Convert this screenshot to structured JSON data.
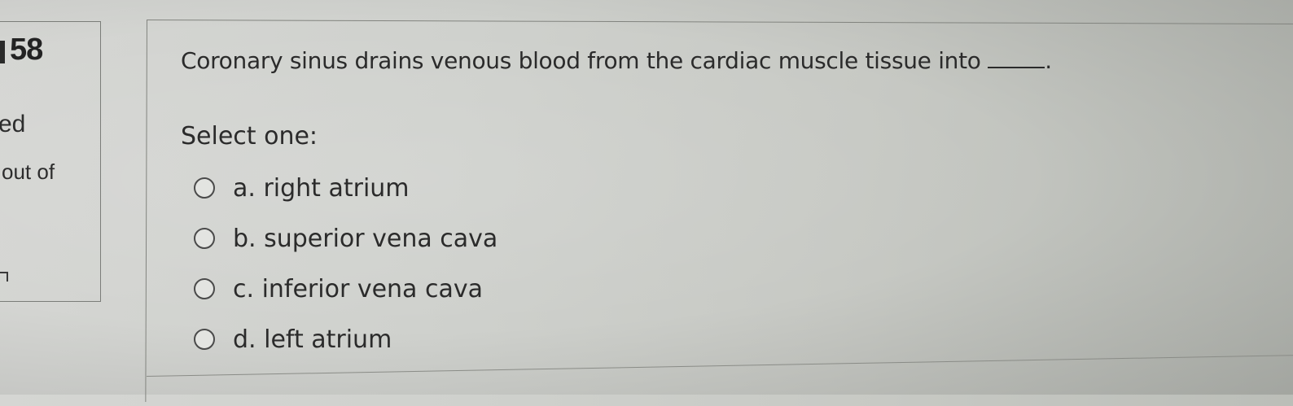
{
  "sidebar": {
    "question_number": "58",
    "state_fragment": "ed",
    "marks_fragment": "out of"
  },
  "question": {
    "text": "Coronary sinus drains venous blood from the cardiac muscle tissue into",
    "trailing": "."
  },
  "prompt": "Select one:",
  "answers": [
    {
      "label": "a. right atrium"
    },
    {
      "label": "b. superior vena cava"
    },
    {
      "label": "c. inferior vena cava"
    },
    {
      "label": "d. left atrium"
    }
  ]
}
